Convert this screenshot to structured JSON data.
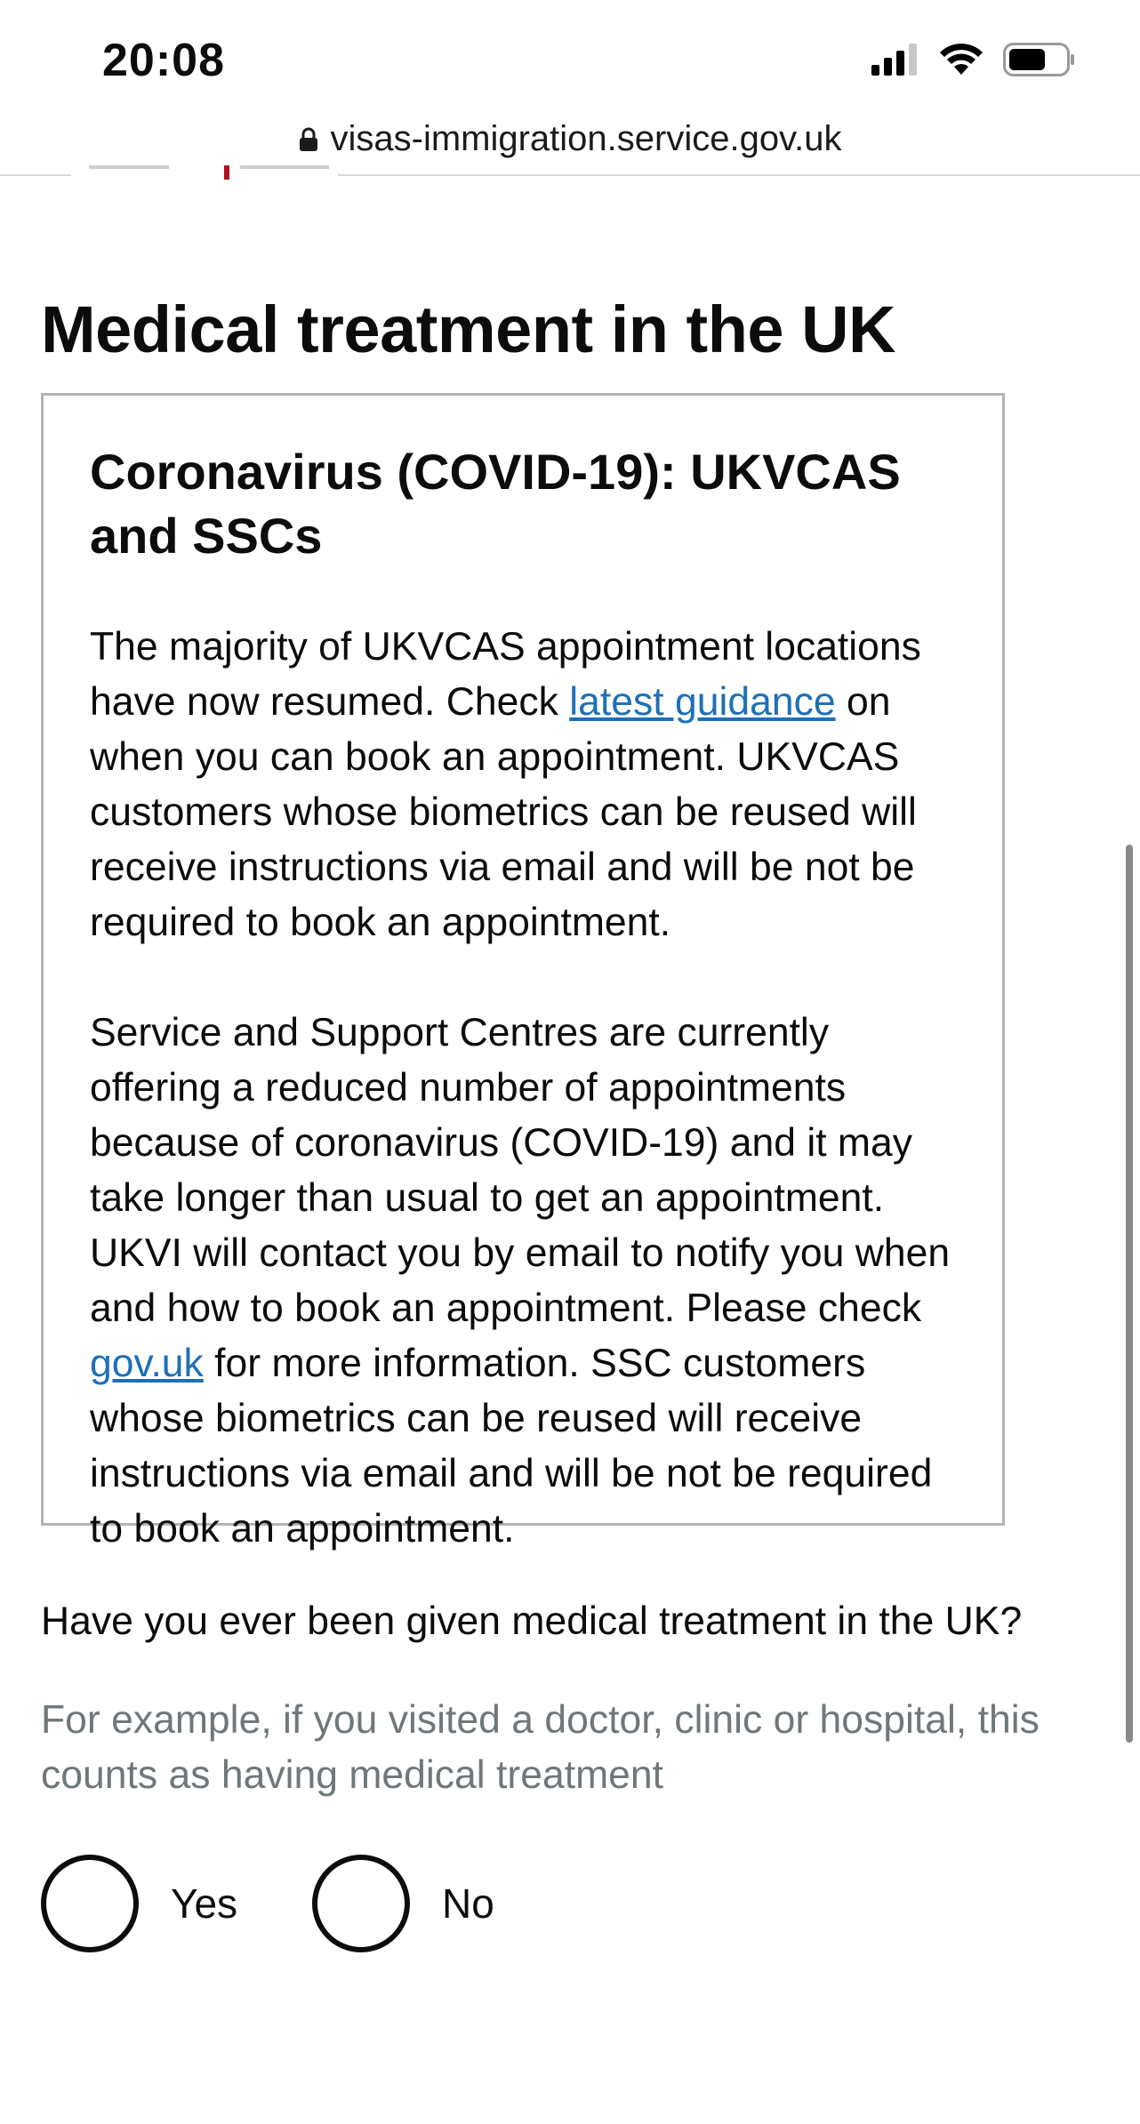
{
  "status_bar": {
    "time": "20:08"
  },
  "browser": {
    "url": "visas-immigration.service.gov.uk"
  },
  "page": {
    "title": "Medical treatment in the UK"
  },
  "notice": {
    "heading": "Coronavirus (COVID-19): UKVCAS and SSCs",
    "p1_before_link": "The majority of UKVCAS appointment locations have now resumed. Check ",
    "p1_link": "latest guidance",
    "p1_after_link": " on when you can book an appointment. UKVCAS customers whose biometrics can be reused will receive instructions via email and will be not be required to book an appointment.",
    "p2_before_link": "Service and Support Centres are currently offering a reduced number of appointments because of coronavirus (COVID-19) and it may take longer than usual to get an appointment. UKVI will contact you by email to notify you when and how to book an appointment. Please check ",
    "p2_link": "gov.uk",
    "p2_after_link": " for more information. SSC customers whose biometrics can be reused will receive instructions via email and will be not be required to book an appointment."
  },
  "question": {
    "label": "Have you ever been given medical treatment in the UK?",
    "hint": "For example, if you visited a doctor, clinic or hospital, this counts as having medical treatment",
    "options": [
      "Yes",
      "No"
    ]
  },
  "icons": {
    "signal": "cellular-signal-icon",
    "wifi": "wifi-icon",
    "battery": "battery-icon",
    "lock": "lock-icon"
  },
  "colors": {
    "link": "#1d70b8",
    "hint": "#6f777b",
    "border": "#b1b4b6"
  }
}
